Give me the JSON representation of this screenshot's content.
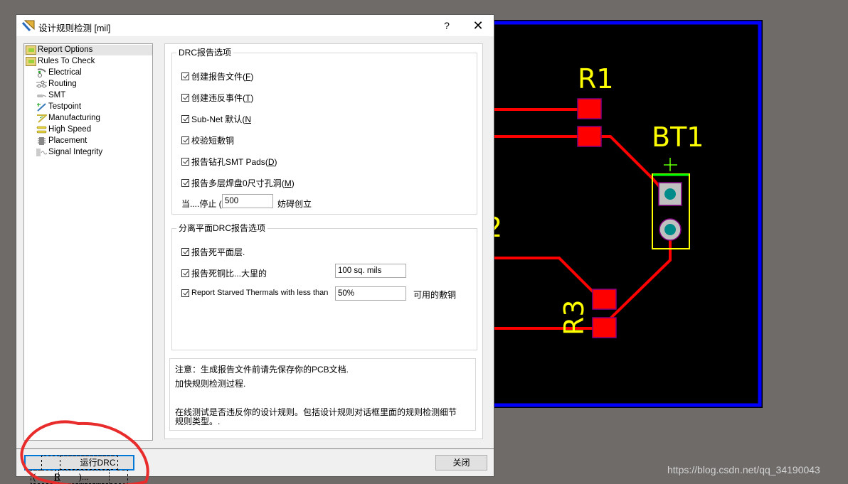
{
  "window": {
    "title": "设计规则检测 [mil]",
    "help_label": "?",
    "close_label": "✕"
  },
  "tree": {
    "items": [
      {
        "label": "Report Options",
        "icon": "folder-icon",
        "selected": true
      },
      {
        "label": "Rules To Check",
        "icon": "folder-icon"
      },
      {
        "label": "Electrical",
        "icon": "electrical-icon"
      },
      {
        "label": "Routing",
        "icon": "routing-icon"
      },
      {
        "label": "SMT",
        "icon": "smt-icon"
      },
      {
        "label": "Testpoint",
        "icon": "testpoint-icon"
      },
      {
        "label": "Manufacturing",
        "icon": "manufacturing-icon"
      },
      {
        "label": "High Speed",
        "icon": "high-speed-icon"
      },
      {
        "label": "Placement",
        "icon": "placement-icon"
      },
      {
        "label": "Signal Integrity",
        "icon": "signal-integrity-icon"
      }
    ]
  },
  "drc_group": {
    "title": "DRC报告选项",
    "options": [
      {
        "label": "创建报告文件 ",
        "accel": "F",
        "checked": true
      },
      {
        "label": "创建违反事件 ",
        "accel": "T",
        "checked": true
      },
      {
        "label": "Sub-Net 默认 ",
        "accel": "N",
        "checked": true
      },
      {
        "label": "校验短敷铜",
        "accel": "",
        "checked": true
      },
      {
        "label": "报告钻孔SMT Pads ",
        "accel": "D",
        "checked": true
      },
      {
        "label": "报告多层焊盘0尺寸孔洞 ",
        "accel": "M",
        "checked": true
      }
    ],
    "stop_prefix": "当....停止 (E",
    "stop_value": "500",
    "stop_suffix": "妨碍创立"
  },
  "plane_group": {
    "title": "分离平面DRC报告选项",
    "dead_plane": {
      "label": "报告死平面层.",
      "checked": true
    },
    "dead_copper": {
      "label": "报告死铜比...大里的",
      "checked": true,
      "value": "100 sq. mils"
    },
    "starved": {
      "label": "Report Starved Thermals with less than",
      "checked": true,
      "value": "50%",
      "suffix": "可用的敷铜"
    }
  },
  "note": {
    "line1": "注意：生成报告文件前请先保存你的PCB文档.",
    "line2": "加快规则检测过程.",
    "line3": "在线测试是否违反你的设计规则。包括设计规则对话框里面的规则检测细节",
    "line4": "规则类型。."
  },
  "buttons": {
    "run_prefix": "运行DRC (",
    "run_accel": "R",
    "run_suffix": ")...",
    "close": "关闭"
  },
  "pcb": {
    "designators": [
      "R1",
      "BT1",
      "R3",
      "2"
    ],
    "plus_mark": "+",
    "colors": {
      "background": "#000000",
      "board_outline": "#0000ff",
      "track": "#ff0000",
      "silkscreen": "#ffff00",
      "pad_outline": "#800080",
      "pad_hole": "#008b8b",
      "pad_body": "#c0c0c0",
      "polarity": "#00ff00"
    }
  },
  "annotation": {
    "color": "#e82b2b"
  },
  "watermark": "https://blog.csdn.net/qq_34190043"
}
